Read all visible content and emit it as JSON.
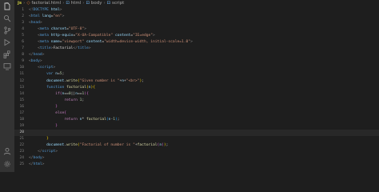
{
  "breadcrumb": {
    "items": [
      {
        "icon": "js",
        "text": "js"
      },
      {
        "icon": "html-file",
        "text": "factorial.html"
      },
      {
        "icon": "tag",
        "text": "html"
      },
      {
        "icon": "tag",
        "text": "body"
      },
      {
        "icon": "tag",
        "text": "script"
      }
    ]
  },
  "code_lines": [
    {
      "n": "1",
      "tokens": [
        [
          "<!",
          "#808080"
        ],
        [
          "DOCTYPE",
          "#569cd6"
        ],
        [
          " ",
          "#d4d4d4"
        ],
        [
          "html",
          "#9cdcfe"
        ],
        [
          ">",
          "#808080"
        ]
      ]
    },
    {
      "n": "2",
      "tokens": [
        [
          "<",
          "#808080"
        ],
        [
          "html",
          "#569cd6"
        ],
        [
          " ",
          "#d4d4d4"
        ],
        [
          "lang",
          "#9cdcfe"
        ],
        [
          "=",
          "#d4d4d4"
        ],
        [
          "\"en\"",
          "#ce9178"
        ],
        [
          ">",
          "#808080"
        ]
      ]
    },
    {
      "n": "3",
      "tokens": [
        [
          "<",
          "#808080"
        ],
        [
          "head",
          "#569cd6"
        ],
        [
          ">",
          "#808080"
        ]
      ]
    },
    {
      "n": "4",
      "tokens": [
        [
          "    ",
          "#d4d4d4"
        ],
        [
          "<",
          "#808080"
        ],
        [
          "meta",
          "#569cd6"
        ],
        [
          " ",
          "#d4d4d4"
        ],
        [
          "charset",
          "#9cdcfe"
        ],
        [
          "=",
          "#d4d4d4"
        ],
        [
          "\"UTF-8\"",
          "#ce9178"
        ],
        [
          ">",
          "#808080"
        ]
      ]
    },
    {
      "n": "5",
      "tokens": [
        [
          "    ",
          "#d4d4d4"
        ],
        [
          "<",
          "#808080"
        ],
        [
          "meta",
          "#569cd6"
        ],
        [
          " ",
          "#d4d4d4"
        ],
        [
          "http-equiv",
          "#9cdcfe"
        ],
        [
          "=",
          "#d4d4d4"
        ],
        [
          "\"X-UA-Compatible\"",
          "#ce9178"
        ],
        [
          " ",
          "#d4d4d4"
        ],
        [
          "content",
          "#9cdcfe"
        ],
        [
          "=",
          "#d4d4d4"
        ],
        [
          "\"IE=edge\"",
          "#ce9178"
        ],
        [
          ">",
          "#808080"
        ]
      ]
    },
    {
      "n": "6",
      "tokens": [
        [
          "    ",
          "#d4d4d4"
        ],
        [
          "<",
          "#808080"
        ],
        [
          "meta",
          "#569cd6"
        ],
        [
          " ",
          "#d4d4d4"
        ],
        [
          "name",
          "#9cdcfe"
        ],
        [
          "=",
          "#d4d4d4"
        ],
        [
          "\"viewport\"",
          "#ce9178"
        ],
        [
          " ",
          "#d4d4d4"
        ],
        [
          "content",
          "#9cdcfe"
        ],
        [
          "=",
          "#d4d4d4"
        ],
        [
          "\"width=device-width, initial-scale=1.0\"",
          "#ce9178"
        ],
        [
          ">",
          "#808080"
        ]
      ]
    },
    {
      "n": "7",
      "tokens": [
        [
          "    ",
          "#d4d4d4"
        ],
        [
          "<",
          "#808080"
        ],
        [
          "title",
          "#569cd6"
        ],
        [
          ">",
          "#808080"
        ],
        [
          "Factorial",
          "#d4d4d4"
        ],
        [
          "</",
          "#808080"
        ],
        [
          "title",
          "#569cd6"
        ],
        [
          ">",
          "#808080"
        ]
      ]
    },
    {
      "n": "8",
      "tokens": [
        [
          "</",
          "#808080"
        ],
        [
          "head",
          "#569cd6"
        ],
        [
          ">",
          "#808080"
        ]
      ]
    },
    {
      "n": "9",
      "tokens": [
        [
          "<",
          "#808080"
        ],
        [
          "body",
          "#569cd6"
        ],
        [
          ">",
          "#808080"
        ]
      ]
    },
    {
      "n": "10",
      "tokens": [
        [
          "    ",
          "#d4d4d4"
        ],
        [
          "<",
          "#808080"
        ],
        [
          "script",
          "#569cd6"
        ],
        [
          ">",
          "#808080"
        ]
      ]
    },
    {
      "n": "11",
      "tokens": [
        [
          "        ",
          "#d4d4d4"
        ],
        [
          "var",
          "#569cd6"
        ],
        [
          " ",
          "#d4d4d4"
        ],
        [
          "n",
          "#9cdcfe"
        ],
        [
          "=",
          "#d4d4d4"
        ],
        [
          "5",
          "#b5cea8"
        ],
        [
          ";",
          "#d4d4d4"
        ]
      ]
    },
    {
      "n": "12",
      "tokens": [
        [
          "        ",
          "#d4d4d4"
        ],
        [
          "document",
          "#9cdcfe"
        ],
        [
          ".",
          "#d4d4d4"
        ],
        [
          "write",
          "#dcdcaa"
        ],
        [
          "(",
          "#ffd700"
        ],
        [
          "\"Given number is \"",
          "#ce9178"
        ],
        [
          "+",
          "#d4d4d4"
        ],
        [
          "n",
          "#9cdcfe"
        ],
        [
          "+",
          "#d4d4d4"
        ],
        [
          "\"<br>\"",
          "#ce9178"
        ],
        [
          ")",
          "#ffd700"
        ],
        [
          ";",
          "#d4d4d4"
        ]
      ]
    },
    {
      "n": "13",
      "tokens": [
        [
          "        ",
          "#d4d4d4"
        ],
        [
          "function",
          "#569cd6"
        ],
        [
          " ",
          "#d4d4d4"
        ],
        [
          "factorial",
          "#dcdcaa"
        ],
        [
          "(",
          "#ffd700"
        ],
        [
          "n",
          "#9cdcfe"
        ],
        [
          ")",
          "#ffd700"
        ],
        [
          "{",
          "#ffd700"
        ]
      ]
    },
    {
      "n": "14",
      "tokens": [
        [
          "            ",
          "#d4d4d4"
        ],
        [
          "if",
          "#c586c0"
        ],
        [
          "(",
          "#da70d6"
        ],
        [
          "n",
          "#9cdcfe"
        ],
        [
          "==",
          "#d4d4d4"
        ],
        [
          "0",
          "#b5cea8"
        ],
        [
          "||",
          "#d4d4d4"
        ],
        [
          "n",
          "#9cdcfe"
        ],
        [
          "==",
          "#d4d4d4"
        ],
        [
          "1",
          "#b5cea8"
        ],
        [
          ")",
          "#da70d6"
        ],
        [
          "{",
          "#da70d6"
        ]
      ]
    },
    {
      "n": "15",
      "tokens": [
        [
          "                ",
          "#d4d4d4"
        ],
        [
          "return",
          "#c586c0"
        ],
        [
          " ",
          "#d4d4d4"
        ],
        [
          "1",
          "#b5cea8"
        ],
        [
          ";",
          "#d4d4d4"
        ]
      ]
    },
    {
      "n": "16",
      "tokens": [
        [
          "            ",
          "#d4d4d4"
        ],
        [
          "}",
          "#da70d6"
        ]
      ]
    },
    {
      "n": "17",
      "tokens": [
        [
          "            ",
          "#d4d4d4"
        ],
        [
          "else",
          "#c586c0"
        ],
        [
          "{",
          "#da70d6"
        ]
      ]
    },
    {
      "n": "18",
      "tokens": [
        [
          "                ",
          "#d4d4d4"
        ],
        [
          "return",
          "#c586c0"
        ],
        [
          " ",
          "#d4d4d4"
        ],
        [
          "n",
          "#9cdcfe"
        ],
        [
          "* ",
          "#d4d4d4"
        ],
        [
          "factorial",
          "#dcdcaa"
        ],
        [
          "(",
          "#179fff"
        ],
        [
          "n",
          "#9cdcfe"
        ],
        [
          "-",
          "#d4d4d4"
        ],
        [
          "1",
          "#b5cea8"
        ],
        [
          ")",
          "#179fff"
        ],
        [
          ";",
          "#d4d4d4"
        ]
      ]
    },
    {
      "n": "19",
      "tokens": [
        [
          "            ",
          "#d4d4d4"
        ],
        [
          "}",
          "#da70d6"
        ]
      ]
    },
    {
      "n": "20",
      "tokens": []
    },
    {
      "n": "21",
      "tokens": [
        [
          "        ",
          "#d4d4d4"
        ],
        [
          "}",
          "#ffd700"
        ]
      ]
    },
    {
      "n": "22",
      "tokens": [
        [
          "        ",
          "#d4d4d4"
        ],
        [
          "document",
          "#9cdcfe"
        ],
        [
          ".",
          "#d4d4d4"
        ],
        [
          "write",
          "#dcdcaa"
        ],
        [
          "(",
          "#ffd700"
        ],
        [
          "\"Factorial of number is \"",
          "#ce9178"
        ],
        [
          "+",
          "#d4d4d4"
        ],
        [
          "factorial",
          "#dcdcaa"
        ],
        [
          "(",
          "#da70d6"
        ],
        [
          "n",
          "#9cdcfe"
        ],
        [
          ")",
          "#da70d6"
        ],
        [
          ")",
          "#ffd700"
        ],
        [
          ";",
          "#d4d4d4"
        ]
      ]
    },
    {
      "n": "23",
      "tokens": [
        [
          "    ",
          "#d4d4d4"
        ],
        [
          "</",
          "#808080"
        ],
        [
          "script",
          "#569cd6"
        ],
        [
          ">",
          "#808080"
        ]
      ]
    },
    {
      "n": "24",
      "tokens": [
        [
          "</",
          "#808080"
        ],
        [
          "body",
          "#569cd6"
        ],
        [
          ">",
          "#808080"
        ]
      ]
    },
    {
      "n": "25",
      "tokens": [
        [
          "</",
          "#808080"
        ],
        [
          "html",
          "#569cd6"
        ],
        [
          ">",
          "#808080"
        ]
      ]
    }
  ],
  "current_line": "20",
  "activity_bar": {
    "top_icons": [
      "files-icon",
      "search-icon",
      "source-control-icon",
      "run-debug-icon",
      "extensions-icon",
      "remote-explorer-icon"
    ],
    "bottom_icons": [
      "account-icon",
      "settings-gear-icon"
    ]
  },
  "colors": {
    "editor_bg": "#1e1e1e",
    "activity_bar_bg": "#333333",
    "line_number": "#858585"
  }
}
